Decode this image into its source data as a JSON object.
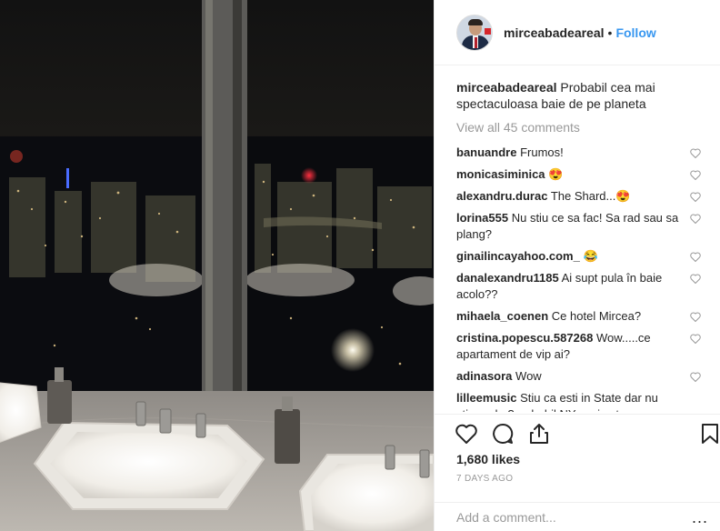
{
  "post": {
    "username": "mirceabadeareal",
    "dot": "•",
    "follow_label": "Follow",
    "caption_user": "mirceabadeareal",
    "caption_text": "Probabil cea mai spectaculoasa baie de pe planeta",
    "view_all": "View all 45 comments",
    "comments": [
      {
        "user": "banuandre",
        "text": "Frumos!"
      },
      {
        "user": "monicasiminica",
        "text": "😍"
      },
      {
        "user": "alexandru.durac",
        "text": "The Shard...😍"
      },
      {
        "user": "lorina555",
        "text": "Nu stiu ce sa fac! Sa rad sau sa plang?"
      },
      {
        "user": "ginailincayahoo.com_",
        "text": "😂"
      },
      {
        "user": "danalexandru1185",
        "text": "Ai supt pula în baie acolo??"
      },
      {
        "user": "mihaela_coenen",
        "text": "Ce hotel Mircea?"
      },
      {
        "user": "cristina.popescu.587268",
        "text": "Wow.....ce apartament de vip ai?"
      },
      {
        "user": "adinasora",
        "text": "Wow"
      },
      {
        "user": "lilleemusic",
        "text": "Stiu ca esti in State dar nu stiu unde ?probabil NY, mai este una"
      }
    ],
    "likes": "1,680 likes",
    "time_ago": "7 DAYS AGO",
    "add_comment_placeholder": "Add a comment...",
    "more_label": "..."
  },
  "icons": {
    "like": "heart-icon",
    "comment": "comment-icon",
    "share": "share-icon",
    "save": "bookmark-icon",
    "comment_like": "heart-small-icon"
  },
  "colors": {
    "link": "#3897f0",
    "text": "#262626",
    "muted": "#999999",
    "border": "#efefef"
  }
}
